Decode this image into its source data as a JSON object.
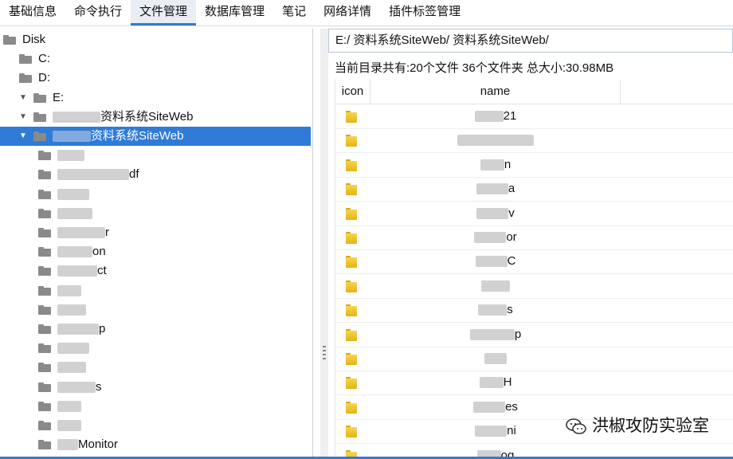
{
  "tabs": [
    {
      "label": "基础信息",
      "active": false
    },
    {
      "label": "命令执行",
      "active": false
    },
    {
      "label": "文件管理",
      "active": true
    },
    {
      "label": "数据库管理",
      "active": false
    },
    {
      "label": "笔记",
      "active": false
    },
    {
      "label": "网络详情",
      "active": false
    },
    {
      "label": "插件标签管理",
      "active": false
    }
  ],
  "tree": {
    "root": "Disk",
    "items": [
      {
        "label": "Disk",
        "level": 0,
        "expanded": true,
        "selected": false
      },
      {
        "label": "C:",
        "level": 1,
        "expanded": false,
        "selected": false
      },
      {
        "label": "D:",
        "level": 1,
        "expanded": false,
        "selected": false
      },
      {
        "label": "E:",
        "level": 1,
        "expanded": true,
        "selected": false
      },
      {
        "label": "资料系统SiteWeb",
        "level": 2,
        "expanded": true,
        "selected": false
      },
      {
        "label": "资料系统SiteWeb",
        "level": 3,
        "expanded": true,
        "selected": true
      },
      {
        "label": "",
        "level": 4
      },
      {
        "label": "df",
        "level": 4
      },
      {
        "label": "",
        "level": 4
      },
      {
        "label": "",
        "level": 4
      },
      {
        "label": "r",
        "level": 4
      },
      {
        "label": "on",
        "level": 4
      },
      {
        "label": "ct",
        "level": 4
      },
      {
        "label": "",
        "level": 4
      },
      {
        "label": "",
        "level": 4
      },
      {
        "label": "p",
        "level": 4
      },
      {
        "label": "",
        "level": 4
      },
      {
        "label": "",
        "level": 4
      },
      {
        "label": "s",
        "level": 4
      },
      {
        "label": "",
        "level": 4
      },
      {
        "label": "",
        "level": 4
      },
      {
        "label": "Monitor",
        "level": 4
      }
    ]
  },
  "path": "E:/  资料系统SiteWeb/  资料系统SiteWeb/",
  "summary": "当前目录共有:20个文件 36个文件夹 总大小:30.98MB",
  "table": {
    "columns": [
      "icon",
      "name"
    ],
    "rows": [
      "21",
      "",
      "n",
      "a",
      "v",
      "or",
      "C",
      "",
      "s",
      "p",
      "",
      "H",
      "es",
      "ni",
      "og"
    ]
  },
  "watermark": "洪椒攻防实验室",
  "colors": {
    "accent": "#2f7bd6",
    "folder_yellow": "#f2c12e",
    "folder_gray": "#8a8a8a"
  }
}
